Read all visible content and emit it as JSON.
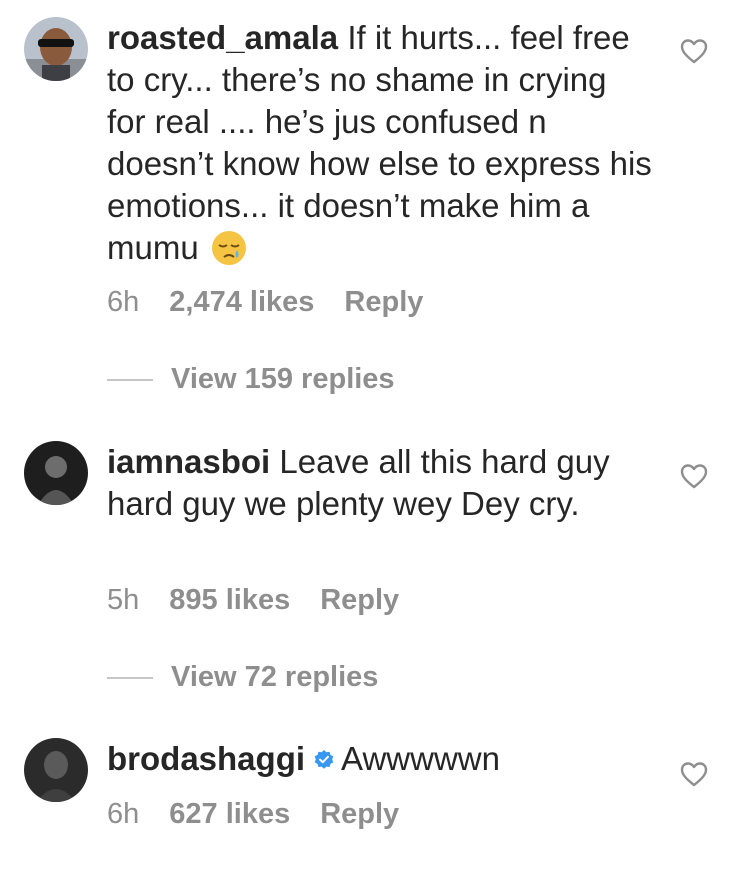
{
  "comments": [
    {
      "username": "roasted_amala",
      "text": "If it hurts... feel free to cry... there’s no shame in crying for real .... he’s jus confused n doesn’t know how else to express his emotions... it doesn’t make him a mumu",
      "emoji": "sleepy-face",
      "time": "6h",
      "likes": "2,474 likes",
      "reply": "Reply",
      "view_replies": "View 159 replies"
    },
    {
      "username": "iamnasboi",
      "text": "Leave all this hard guy hard guy we plenty wey Dey cry.",
      "time": "5h",
      "likes": "895 likes",
      "reply": "Reply",
      "view_replies": "View 72 replies"
    },
    {
      "username": "brodashaggi",
      "verified": true,
      "text": "Awwwwwn",
      "time": "6h",
      "likes": "627 likes",
      "reply": "Reply"
    }
  ],
  "colors": {
    "text": "#262626",
    "meta": "#8e8e8e",
    "verified": "#3897f0",
    "divider": "#c7c7c7"
  },
  "icons": {
    "like": "heart-outline-icon",
    "verified": "verified-badge-icon"
  }
}
